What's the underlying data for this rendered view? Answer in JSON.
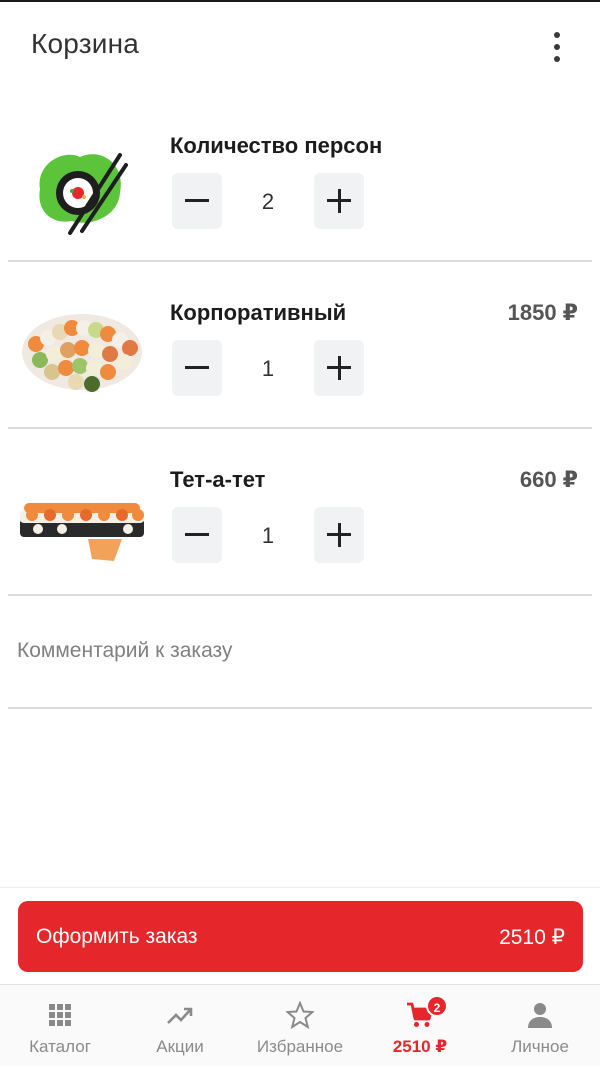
{
  "header": {
    "title": "Корзина",
    "menu_icon": "more-vertical-icon"
  },
  "cart_items": [
    {
      "name": "Количество персон",
      "price": "",
      "quantity": "2",
      "image": "chopsticks-roll-logo"
    },
    {
      "name": "Корпоративный",
      "price": "1850 ₽",
      "quantity": "1",
      "image": "sushi-set-photo"
    },
    {
      "name": "Тет-а-тет",
      "price": "660 ₽",
      "quantity": "1",
      "image": "sushi-rolls-photo"
    }
  ],
  "comment": {
    "placeholder": "Комментарий к заказу",
    "value": ""
  },
  "order": {
    "label": "Оформить заказ",
    "total": "2510 ₽"
  },
  "tabs": [
    {
      "label": "Каталог",
      "icon": "grid-icon",
      "active": false
    },
    {
      "label": "Акции",
      "icon": "trending-up-icon",
      "active": false
    },
    {
      "label": "Избранное",
      "icon": "star-icon",
      "active": false
    },
    {
      "label": "2510 ₽",
      "icon": "cart-icon",
      "active": true,
      "badge": "2"
    },
    {
      "label": "Личное",
      "icon": "user-icon",
      "active": false
    }
  ],
  "colors": {
    "accent": "#e5262a",
    "logo_green": "#5cc43a",
    "divider": "#dcdcdc"
  }
}
